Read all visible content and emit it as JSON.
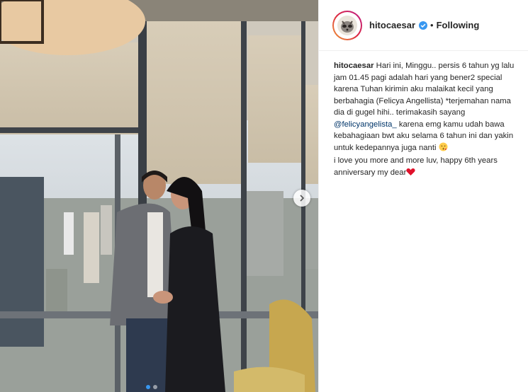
{
  "post": {
    "username": "hitocaesar",
    "follow_status": "Following",
    "separator": "•",
    "caption_part1": "Hari ini, Minggu.. persis 6 tahun yg lalu jam 01.45 pagi adalah hari yang bener2 special karena Tuhan kirimin aku malaikat kecil yang berbahagia (Felicya Angellista) *terjemahan nama dia di gugel hihi.. terimakasih sayang ",
    "mention": "@felicyangelista_",
    "caption_part2": " karena emg kamu udah bawa kebahagiaan bwt aku selama 6 tahun ini dan yakin untuk kedepannya juga nanti ",
    "caption_part3": "i love you more and more luv, happy 6th years anniversary my dear",
    "emoji_kiss": "😘",
    "emoji_heart": "❤"
  },
  "carousel": {
    "slide_count": 2,
    "active_index": 0
  },
  "colors": {
    "verified": "#3897f0",
    "mention": "#003569",
    "heart": "#e0112b"
  }
}
